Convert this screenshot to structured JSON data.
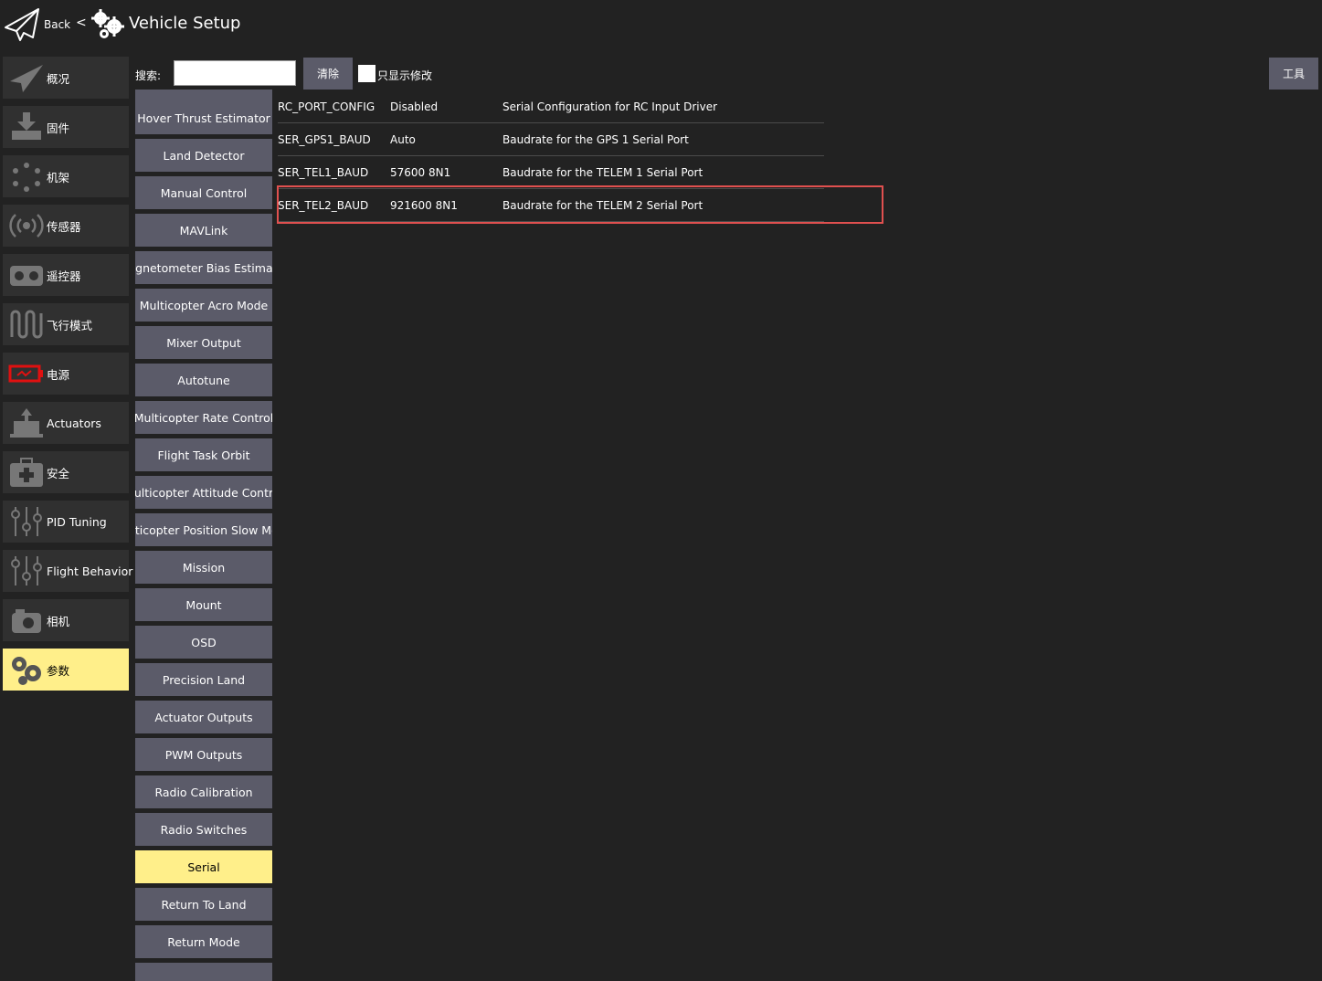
{
  "toolbar": {
    "back_label": "Back",
    "back_chevron": "<",
    "title": "Vehicle Setup"
  },
  "sidebar": {
    "items": [
      {
        "label": "概况",
        "icon": "paper-plane-icon"
      },
      {
        "label": "固件",
        "icon": "firmware-download-icon"
      },
      {
        "label": "机架",
        "icon": "airframe-icon"
      },
      {
        "label": "传感器",
        "icon": "sensors-icon"
      },
      {
        "label": "遥控器",
        "icon": "radio-icon"
      },
      {
        "label": "飞行模式",
        "icon": "flight-modes-icon"
      },
      {
        "label": "电源",
        "icon": "battery-icon"
      },
      {
        "label": "Actuators",
        "icon": "actuator-icon"
      },
      {
        "label": "安全",
        "icon": "safety-icon"
      },
      {
        "label": "PID Tuning",
        "icon": "sliders-icon"
      },
      {
        "label": "Flight Behavior",
        "icon": "sliders-icon"
      },
      {
        "label": "相机",
        "icon": "camera-icon"
      },
      {
        "label": "参数",
        "icon": "gears-icon",
        "active": true
      }
    ]
  },
  "search": {
    "label": "搜索:",
    "value": "",
    "clear_label": "清除",
    "show_modified_label": "只显示修改"
  },
  "tools_label": "工具",
  "groups": [
    "Hover Thrust Estimator",
    "Land Detector",
    "Manual Control",
    "MAVLink",
    "Magnetometer Bias Estimator",
    "Multicopter Acro Mode",
    "Mixer Output",
    "Autotune",
    "Multicopter Rate Control",
    "Flight Task Orbit",
    "Multicopter Attitude Control",
    "Multicopter Position Slow Mode",
    "Mission",
    "Mount",
    "OSD",
    "Precision Land",
    "Actuator Outputs",
    "PWM Outputs",
    "Radio Calibration",
    "Radio Switches",
    "Serial",
    "Return To Land",
    "Return Mode"
  ],
  "active_group": "Serial",
  "params": [
    {
      "name": "RC_PORT_CONFIG",
      "value": "Disabled",
      "desc": "Serial Configuration for RC Input Driver"
    },
    {
      "name": "SER_GPS1_BAUD",
      "value": "Auto",
      "desc": "Baudrate for the GPS 1 Serial Port"
    },
    {
      "name": "SER_TEL1_BAUD",
      "value": "57600 8N1",
      "desc": "Baudrate for the TELEM 1 Serial Port"
    },
    {
      "name": "SER_TEL2_BAUD",
      "value": "921600 8N1",
      "desc": "Baudrate for the TELEM 2 Serial Port"
    }
  ],
  "colors": {
    "background": "#222222",
    "button": "#5b5b69",
    "active": "#ffef8a",
    "highlight": "#e0504f"
  }
}
